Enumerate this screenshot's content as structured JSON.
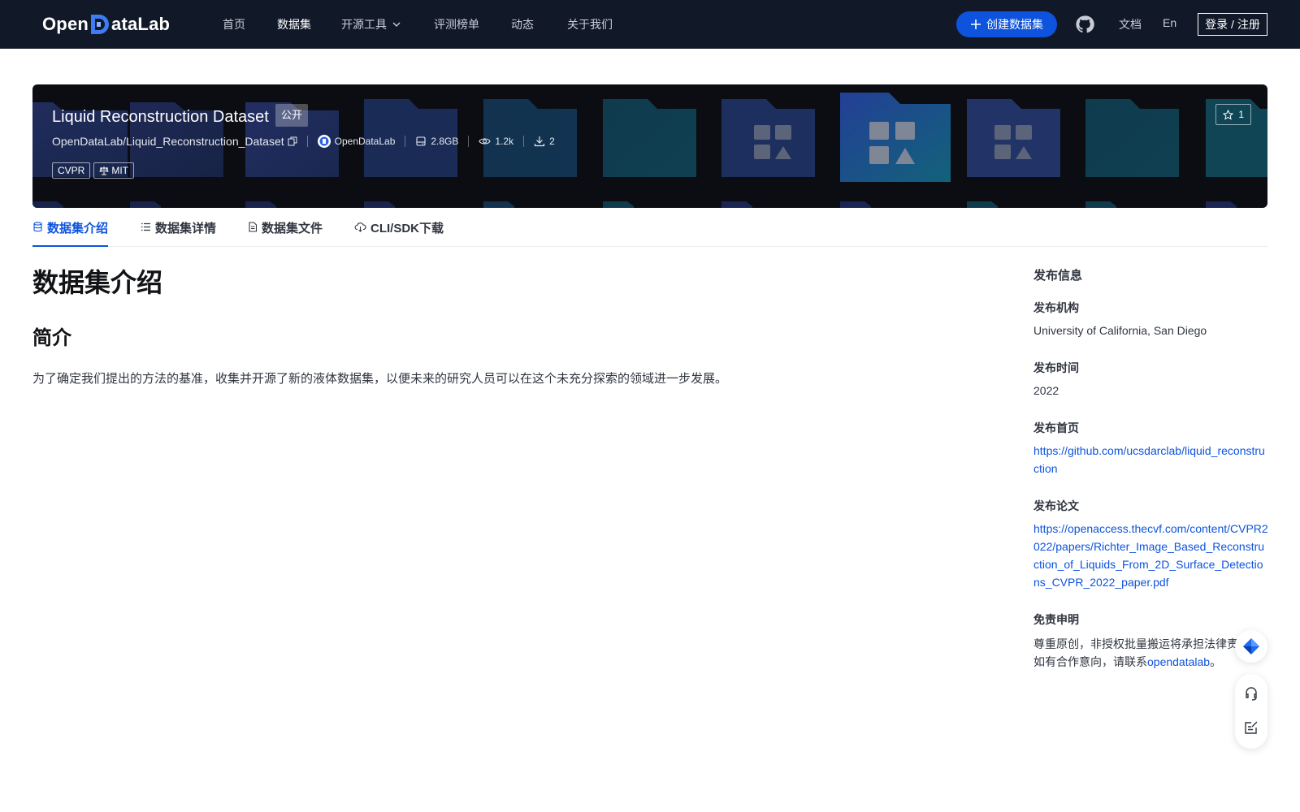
{
  "nav": {
    "logo_left": "Open",
    "logo_right": "ataLab",
    "items": [
      "首页",
      "数据集",
      "开源工具",
      "评测榜单",
      "动态",
      "关于我们"
    ],
    "active_index": 1,
    "create_label": "创建数据集",
    "docs_label": "文档",
    "lang_label": "En",
    "login_label": "登录 / 注册"
  },
  "banner": {
    "title": "Liquid Reconstruction Dataset",
    "visibility": "公开",
    "path": "OpenDataLab/Liquid_Reconstruction_Dataset",
    "publisher": "OpenDataLab",
    "size": "2.8GB",
    "views": "1.2k",
    "downloads": "2",
    "tags": [
      "CVPR",
      "MIT"
    ],
    "stars": "1"
  },
  "tabs": [
    {
      "label": "数据集介绍",
      "icon": "database-icon"
    },
    {
      "label": "数据集详情",
      "icon": "list-icon"
    },
    {
      "label": "数据集文件",
      "icon": "file-icon"
    },
    {
      "label": "CLI/SDK下载",
      "icon": "cloud-download-icon"
    }
  ],
  "main": {
    "heading": "数据集介绍",
    "subheading": "简介",
    "paragraph": "为了确定我们提出的方法的基准，收集并开源了新的液体数据集，以便未来的研究人员可以在这个未充分探索的领域进一步发展。"
  },
  "sidebar": {
    "title": "发布信息",
    "org_label": "发布机构",
    "org_value": "University of California, San Diego",
    "time_label": "发布时间",
    "time_value": "2022",
    "homepage_label": "发布首页",
    "homepage_value": "https://github.com/ucsdarclab/liquid_reconstruction",
    "paper_label": "发布论文",
    "paper_value": "https://openaccess.thecvf.com/content/CVPR2022/papers/Richter_Image_Based_Reconstruction_of_Liquids_From_2D_Surface_Detections_CVPR_2022_paper.pdf",
    "disclaimer_label": "免责申明",
    "disclaimer_line1": "尊重原创，非授权批量搬运将承担法律责",
    "disclaimer_line2_prefix": "如有合作意向，请联系",
    "disclaimer_link": "opendatalab",
    "disclaimer_line2_suffix": "。"
  },
  "colors": {
    "nav_bg": "#111828",
    "primary": "#0d53de",
    "banner_bg": "#0b0d13",
    "text": "#303540"
  }
}
